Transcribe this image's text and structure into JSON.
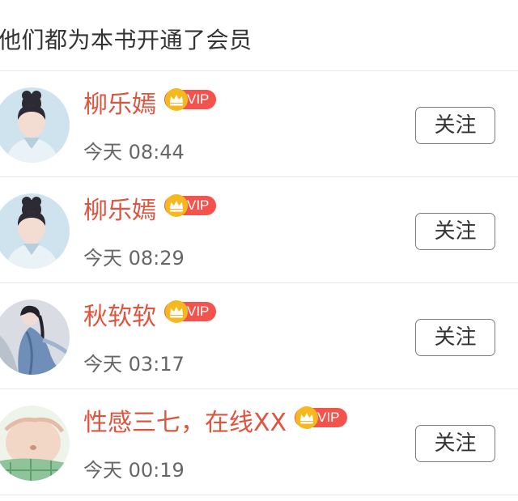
{
  "header": {
    "title": "他们都为本书开通了会员"
  },
  "members": [
    {
      "name": "柳乐嫣",
      "badge": "VIP",
      "time": "今天 08:44",
      "follow_label": "关注",
      "avatar": "avatar-icon"
    },
    {
      "name": "柳乐嫣",
      "badge": "VIP",
      "time": "今天 08:29",
      "follow_label": "关注",
      "avatar": "avatar-icon"
    },
    {
      "name": "秋软软",
      "badge": "VIP",
      "time": "今天 03:17",
      "follow_label": "关注",
      "avatar": "avatar-icon"
    },
    {
      "name": "性感三七，在线XX",
      "badge": "VIP",
      "time": "今天 00:19",
      "follow_label": "关注",
      "avatar": "avatar-icon"
    }
  ],
  "colors": {
    "name": "#e0533d",
    "vip_badge": "#f4524c",
    "crown": "#f6b81f",
    "divider": "#e8e8e8",
    "button_border": "#7a7a7a"
  }
}
